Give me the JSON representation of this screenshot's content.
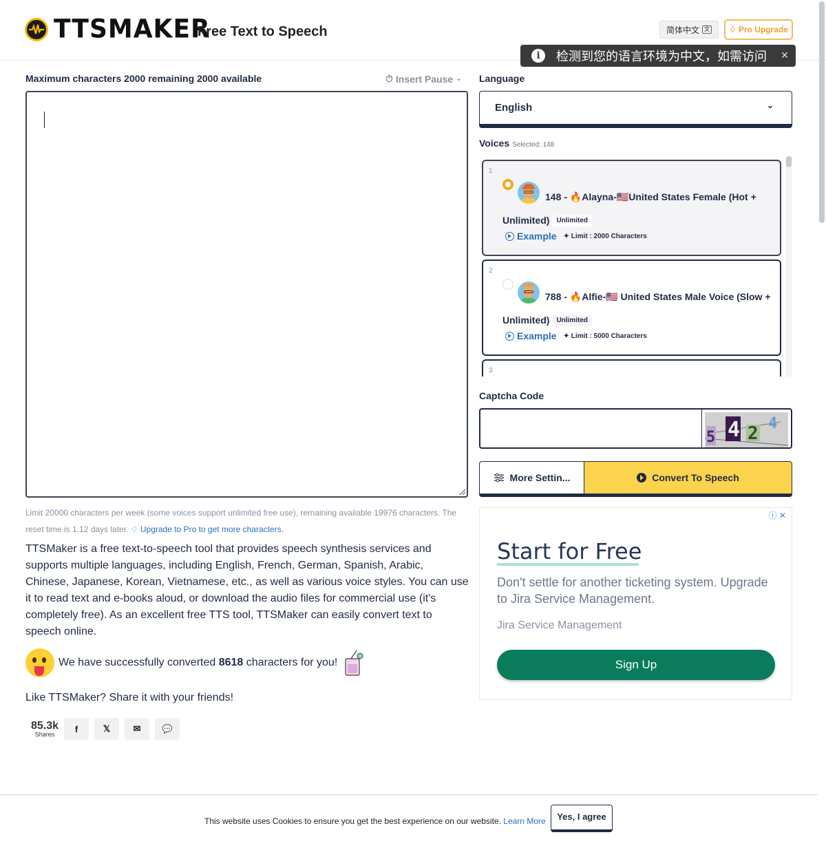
{
  "header": {
    "logo_text": "TTSMAKER",
    "tagline": "Free Text to Speech",
    "lang_switch_label": "简体中文",
    "pro_upgrade_label": "Pro Upgrade"
  },
  "toast": {
    "message": "检测到您的语言环境为中文，如需访问"
  },
  "editor": {
    "char_limit_text": "Maximum characters 2000 remaining 2000 available",
    "insert_pause_label": "Insert Pause",
    "text_value": "",
    "limit_note": "Limit 20000 characters per week (some voices support unlimited free use), remaining available 19976 characters. The reset time is 1.12 days later.",
    "upgrade_link": "Upgrade to Pro to get more characters."
  },
  "description": "TTSMaker is a free text-to-speech tool that provides speech synthesis services and supports multiple languages, including English, French, German, Spanish, Arabic, Chinese, Japanese, Korean, Vietnamese, etc., as well as various voice styles. You can use it to read text and e-books aloud, or download the audio files for commercial use (it's completely free). As an excellent free TTS tool, TTSMaker can easily convert text to speech online.",
  "converted": {
    "prefix": "We have successfully converted",
    "count": "8618",
    "suffix": "characters for you!"
  },
  "share": {
    "question": "Like TTSMaker? Share it with your friends!",
    "count": "85.3k",
    "count_label": "Shares",
    "buttons": [
      {
        "icon": "facebook-icon",
        "glyph": "f"
      },
      {
        "icon": "x-twitter-icon",
        "glyph": "𝕏"
      },
      {
        "icon": "email-icon",
        "glyph": "✉"
      },
      {
        "icon": "wechat-icon",
        "glyph": "💬"
      }
    ]
  },
  "language": {
    "label": "Language",
    "selected": "English"
  },
  "voices": {
    "label": "Voices",
    "selected_text": "Selected: 148",
    "items": [
      {
        "index": "1",
        "name": "148 - 🔥Alayna-🇺🇸United States Female (Hot + Unlimited)",
        "badge": "Unlimited",
        "example": "Example",
        "limit": "Limit : 2000 Characters",
        "selected": true
      },
      {
        "index": "2",
        "name": "788 - 🔥Alfie-🇺🇸 United States Male Voice (Slow + Unlimited)",
        "badge": "Unlimited",
        "example": "Example",
        "limit": "Limit : 5000 Characters",
        "selected": false
      },
      {
        "index": "3"
      }
    ]
  },
  "captcha": {
    "label": "Captcha Code",
    "value": "",
    "image_text": "5424"
  },
  "actions": {
    "more_settings": "More Settin...",
    "convert": "Convert To Speech"
  },
  "ad": {
    "headline": "Start for Free",
    "body": "Don't settle for another ticketing system. Upgrade to Jira Service Management.",
    "brand": "Jira Service Management",
    "cta": "Sign Up",
    "accent_color": "#0a7c5c"
  },
  "cookie": {
    "text": "This website uses Cookies to ensure you get the best experience on our website.",
    "learn_more": "Learn More",
    "agree": "Yes, I agree"
  },
  "colors": {
    "primary_dark": "#1f2a44",
    "accent_yellow": "#fcd34d",
    "link_blue": "#2a6fb8",
    "pro_orange": "#f0a030"
  }
}
